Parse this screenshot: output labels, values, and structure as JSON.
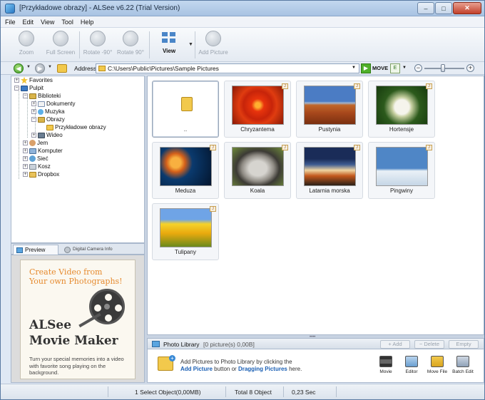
{
  "window": {
    "title": "[Przykładowe obrazy] - ALSee v6.22 (Trial Version)",
    "controls": {
      "minimize": "–",
      "maximize": "□",
      "close": "✕"
    }
  },
  "menu": [
    "File",
    "Edit",
    "View",
    "Tool",
    "Help"
  ],
  "toolbar": {
    "zoom": "Zoom",
    "full_screen": "Full Screen",
    "rotate_left": "Rotate -90°",
    "rotate_right": "Rotate 90°",
    "view": "View",
    "add_picture": "Add Picture"
  },
  "address": {
    "label": "Address",
    "path": "C:\\Users\\Public\\Pictures\\Sample Pictures",
    "move_label": "MOVE",
    "sort_icon": "E"
  },
  "tree": [
    {
      "label": "Favorites",
      "icon": "star-icon",
      "exp": "+"
    },
    {
      "label": "Pulpit",
      "icon": "desktop-icon",
      "exp": "−"
    },
    {
      "label": "Biblioteki",
      "icon": "library-icon",
      "exp": "−"
    },
    {
      "label": "Dokumenty",
      "icon": "documents-icon",
      "exp": "+"
    },
    {
      "label": "Muzyka",
      "icon": "music-icon",
      "exp": "+"
    },
    {
      "label": "Obrazy",
      "icon": "pictures-icon",
      "exp": "−"
    },
    {
      "label": "Przykładowe obrazy",
      "icon": "folder-icon",
      "exp": ""
    },
    {
      "label": "Wideo",
      "icon": "video-icon",
      "exp": "+"
    },
    {
      "label": "Jem",
      "icon": "user-icon",
      "exp": "+"
    },
    {
      "label": "Komputer",
      "icon": "computer-icon",
      "exp": "+"
    },
    {
      "label": "Sieć",
      "icon": "network-icon",
      "exp": "+"
    },
    {
      "label": "Kosz",
      "icon": "trash-icon",
      "exp": "+"
    },
    {
      "label": "Dropbox",
      "icon": "dropbox-folder-icon",
      "exp": "+"
    }
  ],
  "preview": {
    "tab_preview": "Preview",
    "tab_camera": "Digital Camera Info",
    "promo_headline_1": "Create Video from",
    "promo_headline_2": "Your own Photographs!",
    "promo_title_1": "ALSee",
    "promo_title_2": "Movie Maker",
    "promo_desc": "Turn your special memories into a video with favorite song playing on the background."
  },
  "thumbnails": [
    {
      "label": "..",
      "type": "parent-folder"
    },
    {
      "label": "Chryzantema",
      "type": "image"
    },
    {
      "label": "Pustynia",
      "type": "image"
    },
    {
      "label": "Hortensje",
      "type": "image"
    },
    {
      "label": "Meduza",
      "type": "image"
    },
    {
      "label": "Koala",
      "type": "image"
    },
    {
      "label": "Latarnia morska",
      "type": "image"
    },
    {
      "label": "Pingwiny",
      "type": "image"
    },
    {
      "label": "Tulipany",
      "type": "image"
    }
  ],
  "photo_library": {
    "title": "Photo Library",
    "count": "[0 picture(s) 0,00B]",
    "btn_add": "+ Add",
    "btn_delete": "− Delete",
    "btn_empty": "Empty",
    "msg_1": "Add Pictures to Photo Library by clicking the",
    "msg_link_1": "Add Picture",
    "msg_mid": "button or",
    "msg_link_2": "Dragging Pictures",
    "msg_end": "here.",
    "actions": [
      "Movie",
      "Editor",
      "Move File",
      "Batch Edit"
    ]
  },
  "status": {
    "selection": "1 Select Object(0,00MB)",
    "total": "Total 8 Object",
    "time": "0,23 Sec"
  }
}
